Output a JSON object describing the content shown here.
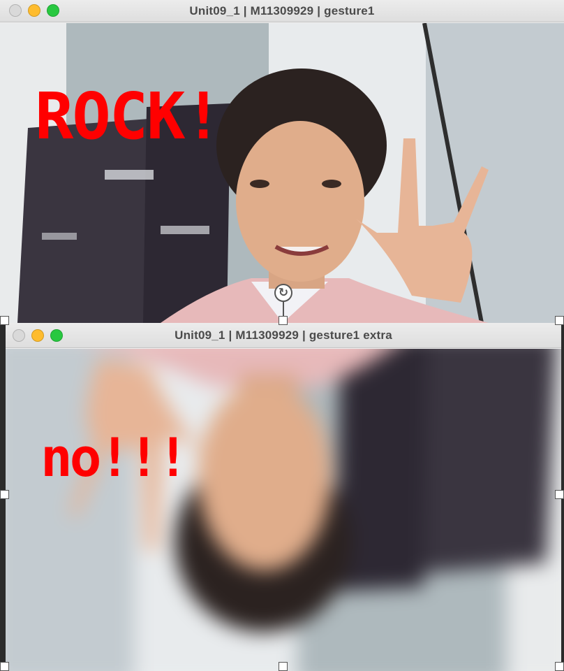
{
  "windows": [
    {
      "title": "Unit09_1 | M11309929 | gesture1",
      "overlay_text": "ROCK!"
    },
    {
      "title": "Unit09_1 | M11309929 | gesture1 extra",
      "overlay_text": "no!!!"
    }
  ],
  "colors": {
    "overlay_text": "#ff0000",
    "traffic_close": "#d9d9d9",
    "traffic_minimize": "#febc2e",
    "traffic_zoom": "#28c840"
  },
  "icons": {
    "rotate_handle": "rotate-icon"
  }
}
